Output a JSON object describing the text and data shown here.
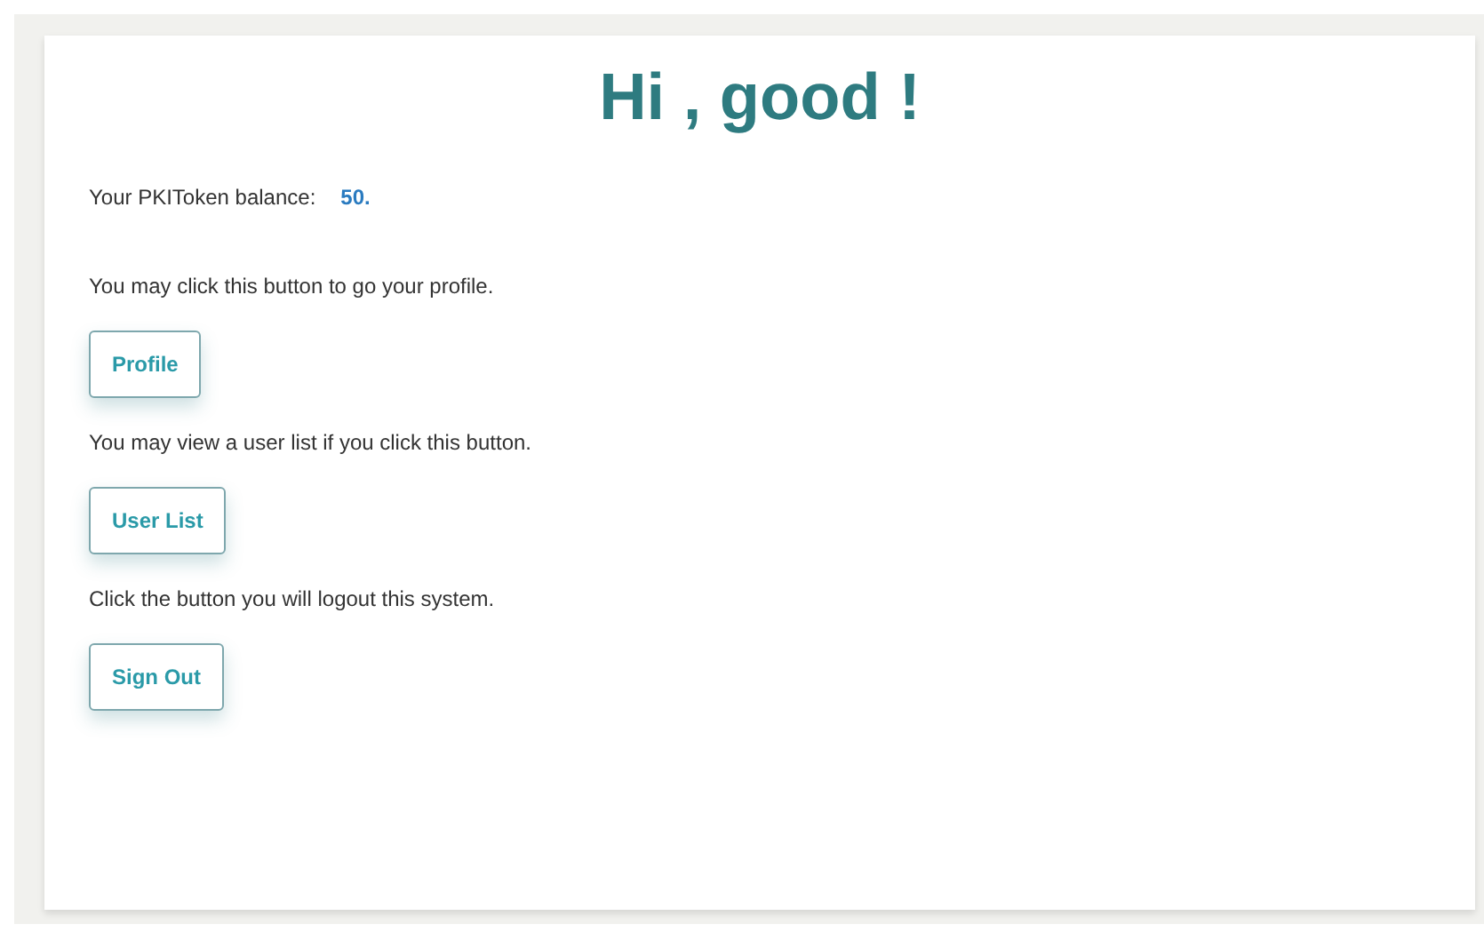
{
  "title": "Hi , good !",
  "balance": {
    "label": "Your PKIToken balance:",
    "value": "50."
  },
  "sections": [
    {
      "text": "You may click this button to go your profile.",
      "button": "Profile"
    },
    {
      "text": "You may view a user list if you click this button.",
      "button": "User List"
    },
    {
      "text": "Click the button you will logout this system.",
      "button": "Sign Out"
    }
  ]
}
